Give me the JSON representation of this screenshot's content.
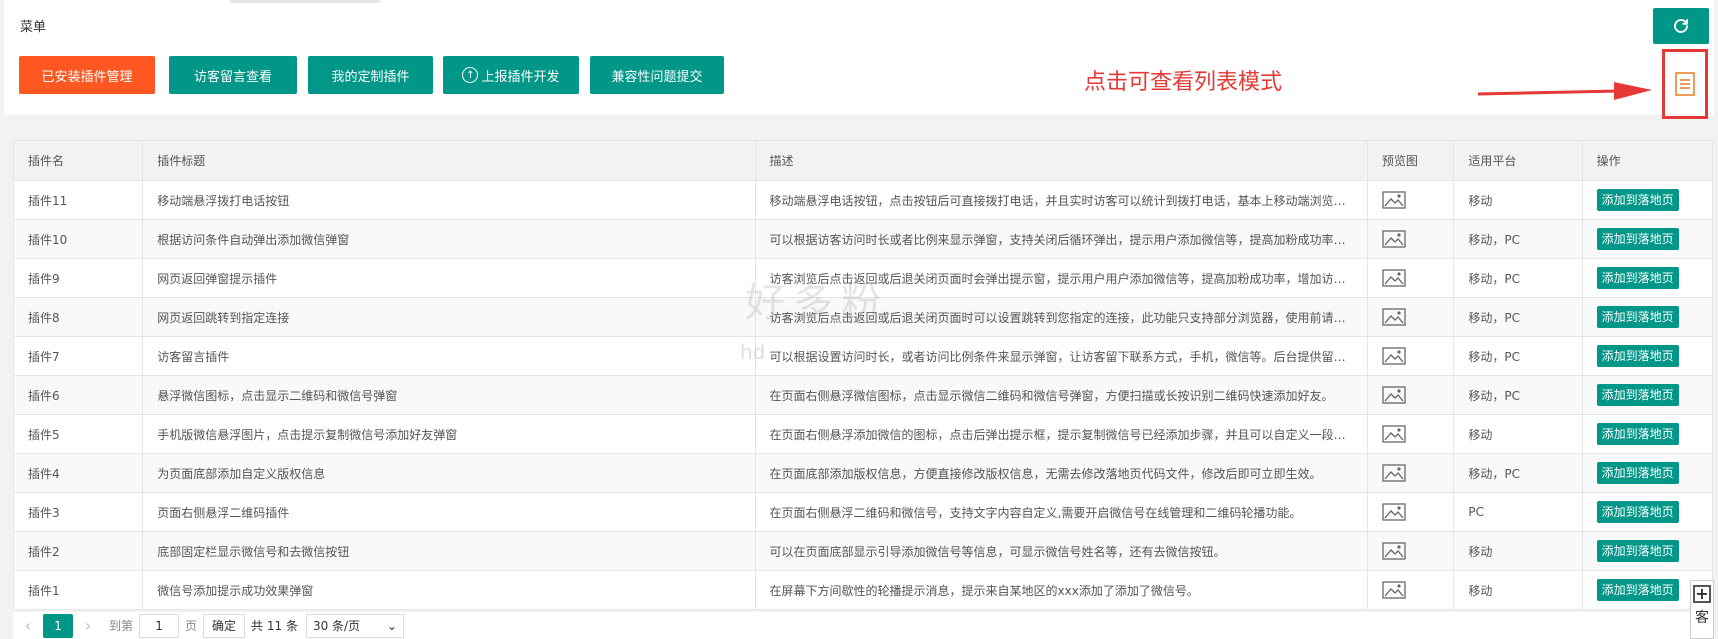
{
  "header": {
    "menu_title": "菜单",
    "buttons": [
      {
        "label": "已安装插件管理",
        "style": "orange"
      },
      {
        "label": "访客留言查看",
        "style": "teal"
      },
      {
        "label": "我的定制插件",
        "style": "teal"
      },
      {
        "label": "上报插件开发",
        "style": "teal",
        "icon": "arrow-up-circle-icon"
      },
      {
        "label": "兼容性问题提交",
        "style": "teal"
      }
    ],
    "annotation": "点击可查看列表模式",
    "refresh_icon": "refresh-icon",
    "list_mode_icon": "list-view-icon"
  },
  "colors": {
    "primary": "#009688",
    "orange": "#ff5722",
    "annotation_red": "#e53935"
  },
  "table": {
    "columns": [
      "插件名",
      "插件标题",
      "描述",
      "预览图",
      "适用平台",
      "操作"
    ],
    "rows": [
      {
        "name": "插件11",
        "title": "移动端悬浮拨打电话按钮",
        "desc": "移动端悬浮电话按钮，点击按钮后可直接拨打电话，并且实时访客可以统计到拨打电话，基本上移动端浏览器...",
        "platform": "移动",
        "action": "添加到落地页"
      },
      {
        "name": "插件10",
        "title": "根据访问条件自动弹出添加微信弹窗",
        "desc": "可以根据访客访问时长或者比例来显示弹窗，支持关闭后循环弹出，提示用户添加微信等，提高加粉成功率，...",
        "platform": "移动，PC",
        "action": "添加到落地页"
      },
      {
        "name": "插件9",
        "title": "网页返回弹窗提示插件",
        "desc": "访客浏览后点击返回或后退关闭页面时会弹出提示窗，提示用户用户添加微信等，提高加粉成功率，增加访客...",
        "platform": "移动，PC",
        "action": "添加到落地页"
      },
      {
        "name": "插件8",
        "title": "网页返回跳转到指定连接",
        "desc": "访客浏览后点击返回或后退关闭页面时可以设置跳转到您指定的连接，此功能只支持部分浏览器，使用前请阅...",
        "platform": "移动，PC",
        "action": "添加到落地页"
      },
      {
        "name": "插件7",
        "title": "访客留言插件",
        "desc": "可以根据设置访问时长，或者访问比例条件来显示弹窗，让访客留下联系方式，手机，微信等。后台提供留言...",
        "platform": "移动，PC",
        "action": "添加到落地页"
      },
      {
        "name": "插件6",
        "title": "悬浮微信图标，点击显示二维码和微信号弹窗",
        "desc": "在页面右侧悬浮微信图标，点击显示微信二维码和微信号弹窗，方便扫描或长按识别二维码快速添加好友。",
        "platform": "移动，PC",
        "action": "添加到落地页"
      },
      {
        "name": "插件5",
        "title": "手机版微信悬浮图片，点击提示复制微信号添加好友弹窗",
        "desc": "在页面右侧悬浮添加微信的图标，点击后弹出提示框，提示复制微信号已经添加步骤，并且可以自定义一段提...",
        "platform": "移动",
        "action": "添加到落地页"
      },
      {
        "name": "插件4",
        "title": "为页面底部添加自定义版权信息",
        "desc": "在页面底部添加版权信息，方便直接修改版权信息，无需去修改落地页代码文件，修改后即可立即生效。",
        "platform": "移动，PC",
        "action": "添加到落地页"
      },
      {
        "name": "插件3",
        "title": "页面右侧悬浮二维码插件",
        "desc": "在页面右侧悬浮二维码和微信号，支持文字内容自定义,需要开启微信号在线管理和二维码轮播功能。",
        "platform": "PC",
        "action": "添加到落地页"
      },
      {
        "name": "插件2",
        "title": "底部固定栏显示微信号和去微信按钮",
        "desc": "可以在页面底部显示引导添加微信号等信息，可显示微信号姓名等，还有去微信按钮。",
        "platform": "移动",
        "action": "添加到落地页"
      },
      {
        "name": "插件1",
        "title": "微信号添加提示成功效果弹窗",
        "desc": "在屏幕下方间歇性的轮播提示消息，提示来自某地区的xxx添加了添加了微信号。",
        "platform": "移动",
        "action": "添加到落地页"
      }
    ],
    "preview_icon": "image-icon"
  },
  "pager": {
    "current": "1",
    "goto_prefix": "到第",
    "goto_value": "1",
    "goto_suffix": "页",
    "confirm": "确定",
    "total": "共 11 条",
    "page_size": "30 条/页"
  },
  "side_tool": {
    "label": "客"
  },
  "watermark": {
    "text": "好多粉",
    "sub": "hd"
  }
}
